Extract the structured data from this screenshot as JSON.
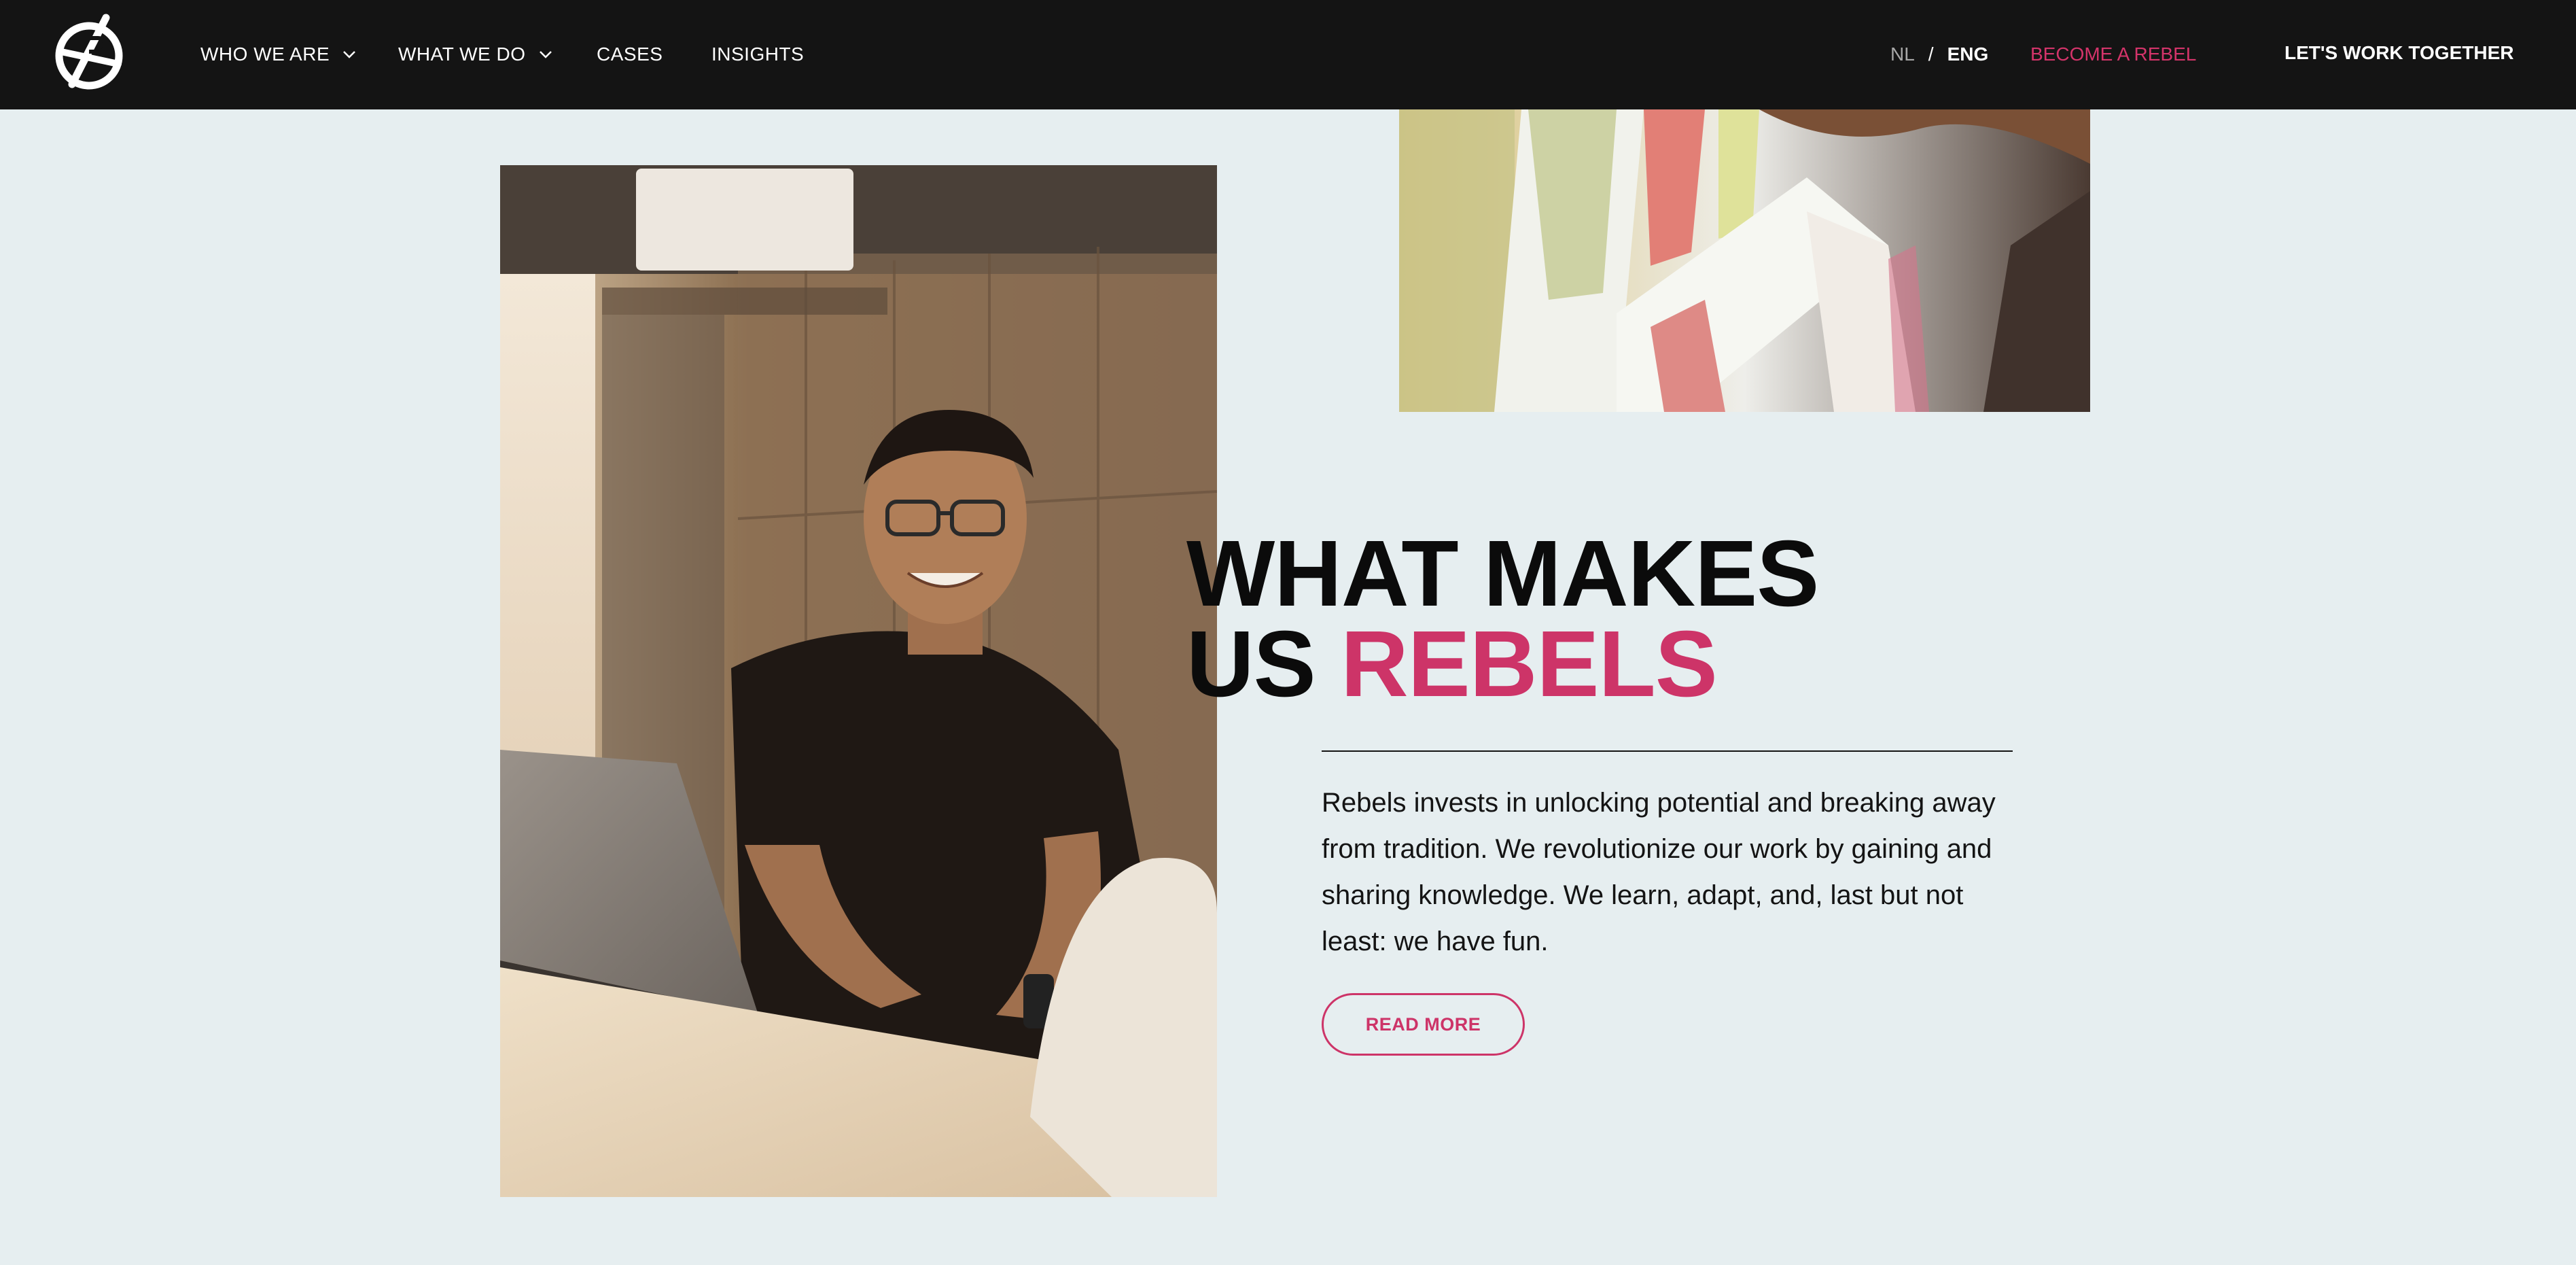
{
  "nav": {
    "items": [
      {
        "label": "WHO WE ARE"
      },
      {
        "label": "WHAT WE DO"
      },
      {
        "label": "CASES"
      },
      {
        "label": "INSIGHTS"
      }
    ],
    "lang": {
      "nl": "NL",
      "separator": "/",
      "eng": "ENG"
    },
    "become_rebel": "BECOME A REBEL",
    "cta": "LET'S WORK TOGETHER"
  },
  "hero": {
    "heading_line1": "WHAT MAKES",
    "heading_line2_prefix": "US",
    "heading_line2_accent": "REBELS",
    "body": "Rebels invests in unlocking potential and breaking away from tradition. We revolutionize our work by gaining and sharing knowledge. We learn, adapt, and, last but not least: we have fun.",
    "button_label": "READ MORE"
  },
  "colors": {
    "navbar": "#141414",
    "page_background": "#e6eef0",
    "accent": "#cd3468",
    "text": "#141414"
  },
  "icons": {
    "logo": "rebels-logo-icon",
    "dropdown": "chevron-down-icon"
  }
}
